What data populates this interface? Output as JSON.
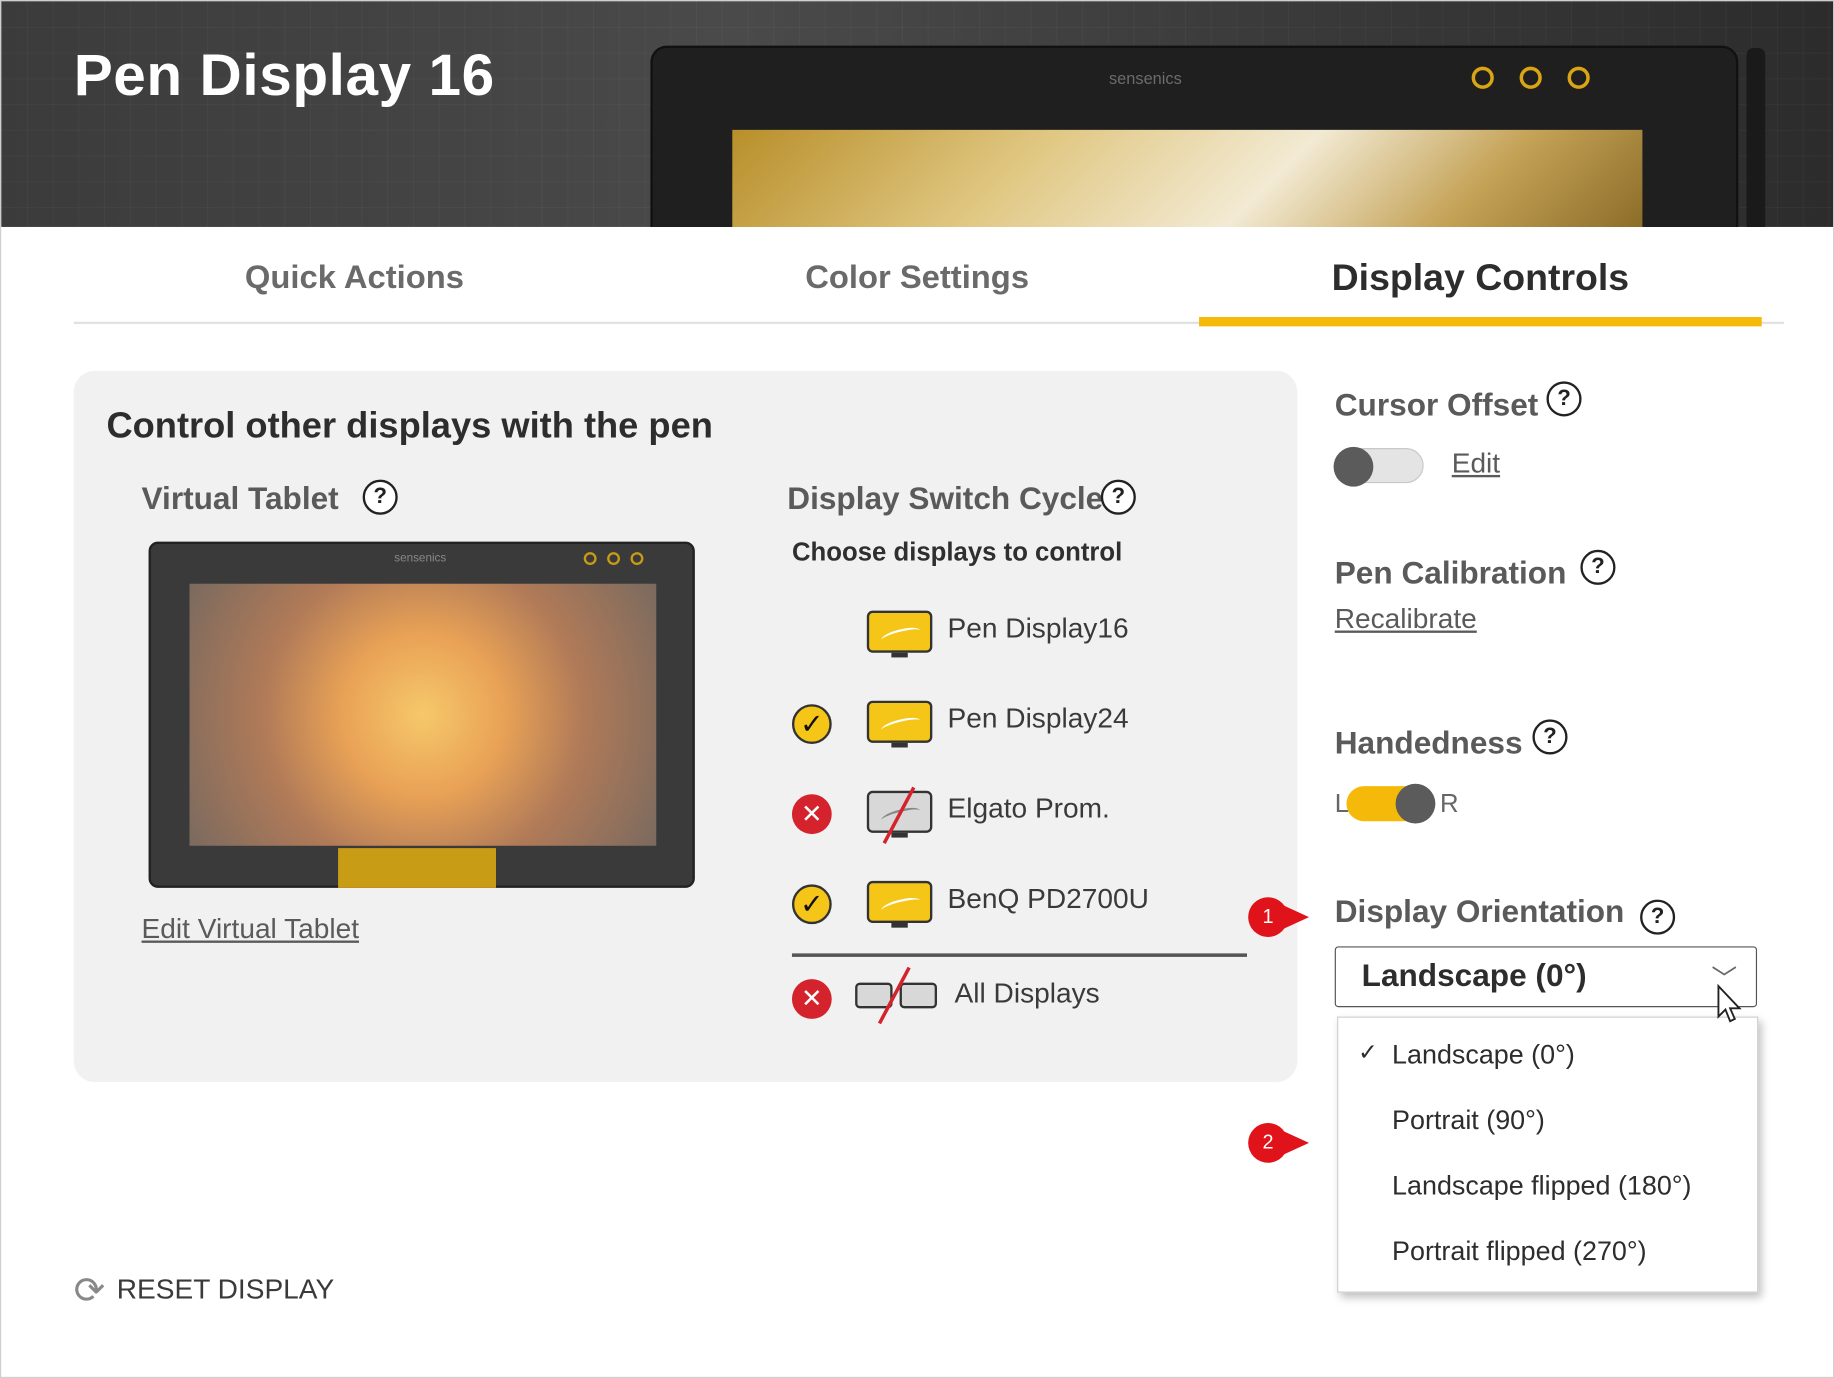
{
  "header": {
    "title": "Pen Display 16",
    "device_logo": "sensenics"
  },
  "tabs": [
    {
      "label": "Quick Actions",
      "active": false
    },
    {
      "label": "Color Settings",
      "active": false
    },
    {
      "label": "Display Controls",
      "active": true
    }
  ],
  "panel": {
    "title": "Control other displays with the pen",
    "virtual_tablet": {
      "label": "Virtual Tablet",
      "edit_link": "Edit Virtual Tablet"
    },
    "display_switch_cycle": {
      "label": "Display Switch Cycle",
      "subtitle": "Choose displays to control",
      "displays": [
        {
          "name": "Pen Display16",
          "status": "none",
          "monitor": "on"
        },
        {
          "name": "Pen Display24",
          "status": "check",
          "monitor": "on"
        },
        {
          "name": "Elgato Prom.",
          "status": "cross",
          "monitor": "off"
        },
        {
          "name": "BenQ PD2700U",
          "status": "check",
          "monitor": "on"
        }
      ],
      "all_displays": {
        "name": "All Displays",
        "status": "cross"
      }
    }
  },
  "right": {
    "cursor_offset": {
      "label": "Cursor Offset",
      "toggle_on": false,
      "edit_link": "Edit"
    },
    "pen_calibration": {
      "label": "Pen Calibration",
      "link": "Recalibrate"
    },
    "handedness": {
      "label": "Handedness",
      "left": "L",
      "right": "R",
      "value": "R"
    },
    "display_orientation": {
      "label": "Display Orientation",
      "selected": "Landscape (0°)",
      "options": [
        "Landscape (0°)",
        "Portrait (90°)",
        "Landscape flipped (180°)",
        "Portrait flipped (270°)"
      ]
    }
  },
  "markers": [
    "1",
    "2"
  ],
  "reset": {
    "label": "RESET DISPLAY",
    "icon": "refresh-icon"
  },
  "icons": {
    "help": "?",
    "check": "✓",
    "cross": "✕",
    "chevron": "﹀",
    "reset": "⟳"
  },
  "colors": {
    "accent": "#f5b90a",
    "error": "#d4232d",
    "marker": "#e0121a"
  }
}
